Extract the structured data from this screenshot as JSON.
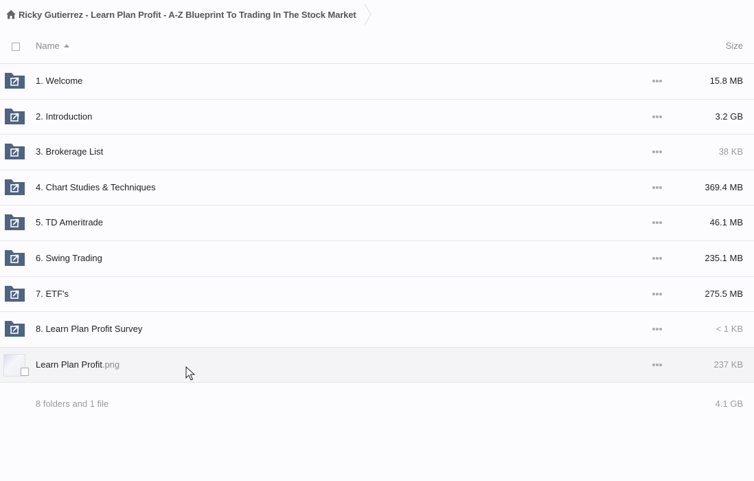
{
  "breadcrumb": {
    "title": "Ricky Gutierrez - Learn Plan Profit - A-Z Blueprint To Trading In The Stock Market"
  },
  "columns": {
    "name": "Name",
    "size": "Size"
  },
  "items": [
    {
      "name": "1. Welcome",
      "ext": "",
      "size": "15.8 MB",
      "type": "folder"
    },
    {
      "name": "2. Introduction",
      "ext": "",
      "size": "3.2 GB",
      "type": "folder"
    },
    {
      "name": "3. Brokerage List",
      "ext": "",
      "size": "38 KB",
      "type": "folder"
    },
    {
      "name": "4. Chart Studies & Techniques",
      "ext": "",
      "size": "369.4 MB",
      "type": "folder"
    },
    {
      "name": "5. TD Ameritrade",
      "ext": "",
      "size": "46.1 MB",
      "type": "folder"
    },
    {
      "name": "6. Swing Trading",
      "ext": "",
      "size": "235.1 MB",
      "type": "folder"
    },
    {
      "name": "7. ETF's",
      "ext": "",
      "size": "275.5 MB",
      "type": "folder"
    },
    {
      "name": "8. Learn Plan Profit Survey",
      "ext": "",
      "size": "< 1 KB",
      "type": "folder"
    },
    {
      "name": "Learn Plan Profit",
      "ext": ".png",
      "size": "237 KB",
      "type": "file"
    }
  ],
  "footer": {
    "summary": "8 folders and 1 file",
    "total": "4.1 GB"
  },
  "icons": {
    "home": "home-icon",
    "folder": "shared-folder-icon",
    "more": "more-icon",
    "sort": "sort-ascending-icon"
  },
  "colors": {
    "folder": "#4f6382",
    "background": "#fcfcfe",
    "hover_row": "#f4f4f6"
  }
}
